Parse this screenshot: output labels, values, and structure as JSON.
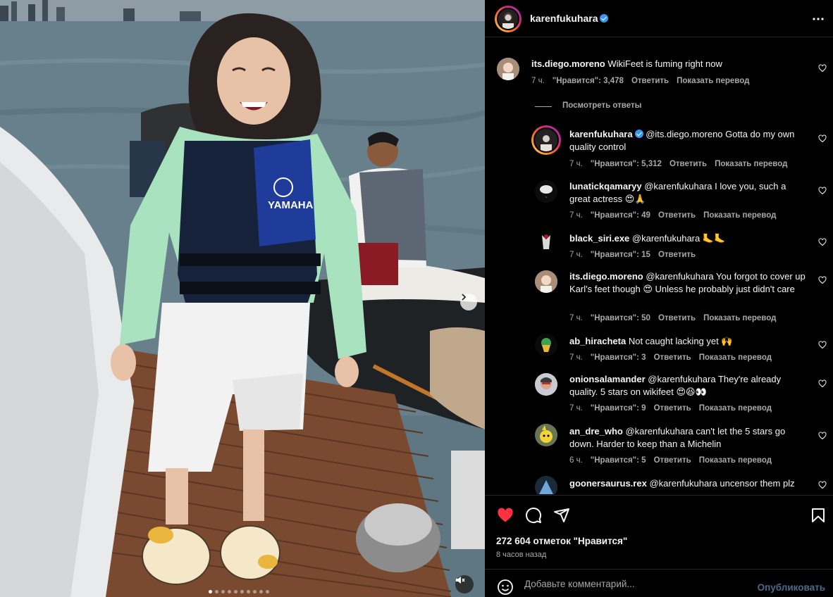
{
  "post": {
    "author": "karenfukuhara",
    "verified": true,
    "likes_text": "272 604 отметок \"Нравится\"",
    "time_text": "8 часов назад",
    "carousel": {
      "slides": 10,
      "active": 0
    }
  },
  "comments": [
    {
      "user": "its.diego.moreno",
      "text": "WikiFeet is fuming right now",
      "time": "7 ч.",
      "likes": "\"Нравится\": 3,478",
      "reply": "Ответить",
      "translate": "Показать перевод",
      "view_replies": "Посмотреть ответы"
    },
    {
      "user": "karenfukuhara",
      "verified": true,
      "text": "@its.diego.moreno Gotta do my own quality control",
      "time": "7 ч.",
      "likes": "\"Нравится\": 5,312",
      "reply": "Ответить",
      "translate": "Показать перевод"
    },
    {
      "user": "lunatickqamaryy",
      "text": "@karenfukuhara I love you, such a great actress 😍🙏",
      "time": "7 ч.",
      "likes": "\"Нравится\": 49",
      "reply": "Ответить",
      "translate": "Показать перевод"
    },
    {
      "user": "black_siri.exe",
      "text": "@karenfukuhara 🦶🦶",
      "time": "7 ч.",
      "likes": "\"Нравится\": 15",
      "reply": "Ответить"
    },
    {
      "user": "its.diego.moreno",
      "text": "@karenfukuhara You forgot to cover up Karl's feet though 😍 Unless he probably just didn't care",
      "time": "7 ч.",
      "likes": "\"Нравится\": 50",
      "reply": "Ответить",
      "translate": "Показать перевод"
    },
    {
      "user": "ab_hiracheta",
      "text": "Not caught lacking yet 🙌",
      "time": "7 ч.",
      "likes": "\"Нравится\": 3",
      "reply": "Ответить",
      "translate": "Показать перевод"
    },
    {
      "user": "onionsalamander",
      "text": "@karenfukuhara They're already quality. 5 stars on wikifeet 😍😆👀",
      "time": "7 ч.",
      "likes": "\"Нравится\": 9",
      "reply": "Ответить",
      "translate": "Показать перевод"
    },
    {
      "user": "an_dre_who",
      "text": "@karenfukuhara can't let the 5 stars go down. Harder to keep than a Michelin",
      "time": "6 ч.",
      "likes": "\"Нравится\": 5",
      "reply": "Ответить",
      "translate": "Показать перевод"
    },
    {
      "user": "goonersaurus.rex",
      "text": "@karenfukuhara uncensor them plz"
    }
  ],
  "composer": {
    "placeholder": "Добавьте комментарий...",
    "post_label": "Опубликовать"
  },
  "colors": {
    "like_red": "#ff3040",
    "verified_blue": "#3897f0",
    "post_blue": "#4b6a8e"
  },
  "icons": [
    "more-icon",
    "heart-icon",
    "comment-icon",
    "share-icon",
    "bookmark-icon",
    "emoji-icon",
    "chevron-right-icon",
    "mute-icon"
  ]
}
